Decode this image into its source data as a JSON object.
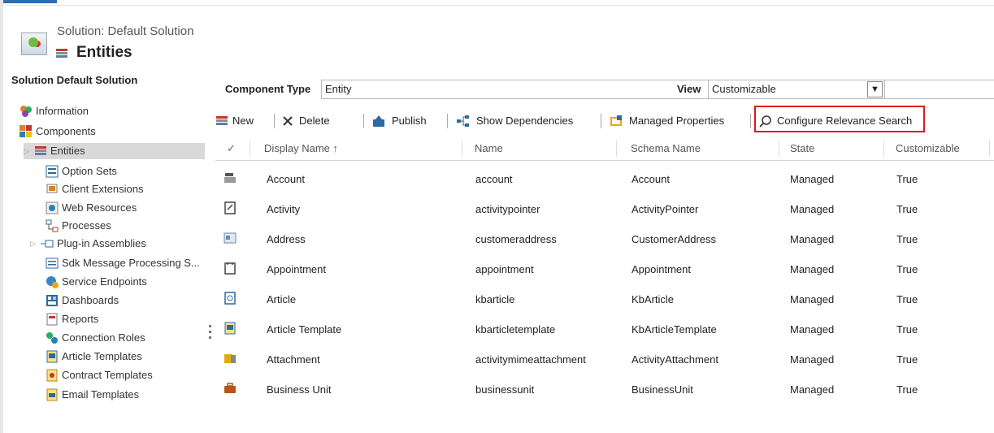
{
  "header": {
    "subtitle": "Solution: Default Solution",
    "title": "Entities"
  },
  "sidebar": {
    "heading": "Solution Default Solution",
    "items": [
      {
        "label": "Information",
        "icon": "information-icon"
      },
      {
        "label": "Components",
        "icon": "components-icon"
      },
      {
        "label": "Entities",
        "icon": "entities-icon",
        "selected": true
      },
      {
        "label": "Option Sets",
        "icon": "option-sets-icon"
      },
      {
        "label": "Client Extensions",
        "icon": "client-extensions-icon"
      },
      {
        "label": "Web Resources",
        "icon": "web-resources-icon"
      },
      {
        "label": "Processes",
        "icon": "processes-icon"
      },
      {
        "label": "Plug-in Assemblies",
        "icon": "plugin-assemblies-icon"
      },
      {
        "label": "Sdk Message Processing S...",
        "icon": "sdk-message-icon"
      },
      {
        "label": "Service Endpoints",
        "icon": "service-endpoints-icon"
      },
      {
        "label": "Dashboards",
        "icon": "dashboards-icon"
      },
      {
        "label": "Reports",
        "icon": "reports-icon"
      },
      {
        "label": "Connection Roles",
        "icon": "connection-roles-icon"
      },
      {
        "label": "Article Templates",
        "icon": "article-templates-icon"
      },
      {
        "label": "Contract Templates",
        "icon": "contract-templates-icon"
      },
      {
        "label": "Email Templates",
        "icon": "email-templates-icon"
      }
    ]
  },
  "component_type": {
    "label": "Component Type",
    "value": "Entity",
    "view_label": "View",
    "view_value": "Customizable"
  },
  "toolbar": {
    "new": "New",
    "delete": "Delete",
    "publish": "Publish",
    "show_dependencies": "Show Dependencies",
    "managed_properties": "Managed Properties",
    "configure_relevance_search": "Configure Relevance Search"
  },
  "table": {
    "columns": [
      "Display Name ↑",
      "Name",
      "Schema Name",
      "State",
      "Customizable"
    ],
    "rows": [
      {
        "display": "Account",
        "name": "account",
        "schema": "Account",
        "state": "Managed",
        "custom": "True",
        "icon": "account-icon"
      },
      {
        "display": "Activity",
        "name": "activitypointer",
        "schema": "ActivityPointer",
        "state": "Managed",
        "custom": "True",
        "icon": "activity-icon"
      },
      {
        "display": "Address",
        "name": "customeraddress",
        "schema": "CustomerAddress",
        "state": "Managed",
        "custom": "True",
        "icon": "address-icon"
      },
      {
        "display": "Appointment",
        "name": "appointment",
        "schema": "Appointment",
        "state": "Managed",
        "custom": "True",
        "icon": "appointment-icon"
      },
      {
        "display": "Article",
        "name": "kbarticle",
        "schema": "KbArticle",
        "state": "Managed",
        "custom": "True",
        "icon": "article-icon"
      },
      {
        "display": "Article Template",
        "name": "kbarticletemplate",
        "schema": "KbArticleTemplate",
        "state": "Managed",
        "custom": "True",
        "icon": "article-template-icon"
      },
      {
        "display": "Attachment",
        "name": "activitymimeattachment",
        "schema": "ActivityAttachment",
        "state": "Managed",
        "custom": "True",
        "icon": "attachment-icon"
      },
      {
        "display": "Business Unit",
        "name": "businessunit",
        "schema": "BusinessUnit",
        "state": "Managed",
        "custom": "True",
        "icon": "business-unit-icon"
      }
    ]
  },
  "colors": {
    "highlight": "#e0161d",
    "accent": "#2f6db5",
    "selected_bg": "#d9d9d9"
  }
}
